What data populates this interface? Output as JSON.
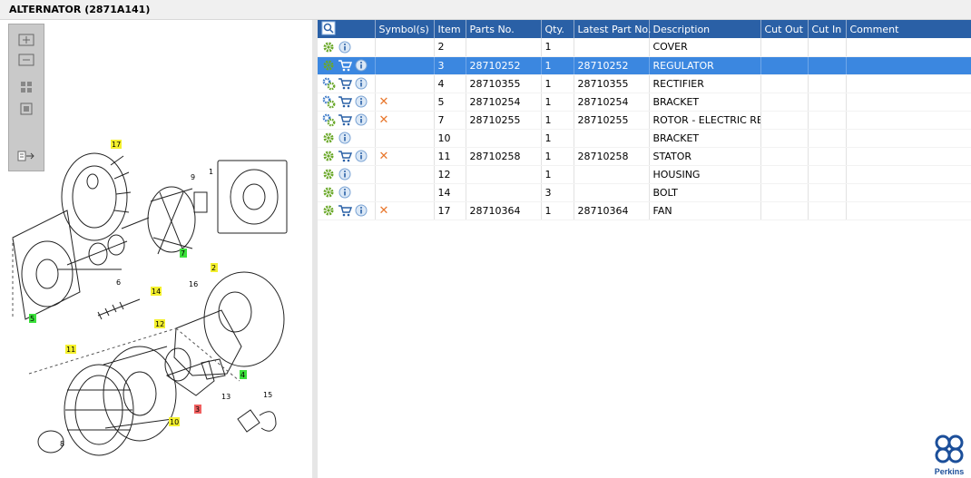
{
  "window": {
    "title": "ALTERNATOR (2871A141)"
  },
  "toolbar": {
    "buttons": [
      "zoom-in",
      "zoom-out",
      "fit-page",
      "actual-size",
      "export"
    ]
  },
  "diagram": {
    "callouts": [
      "17",
      "9",
      "1",
      "2",
      "16",
      "7",
      "6",
      "14",
      "5",
      "12",
      "11",
      "4",
      "13",
      "15",
      "3",
      "10",
      "8"
    ]
  },
  "table": {
    "headers": [
      "Symbol(s)",
      "Item",
      "Parts No.",
      "Qty.",
      "Latest Part No.",
      "Description",
      "Cut Out",
      "Cut In",
      "Comment"
    ],
    "rows": [
      {
        "item": "2",
        "part_no": "",
        "qty": "1",
        "latest": "",
        "desc": "COVER",
        "cart": false,
        "x": false,
        "gears": 1
      },
      {
        "item": "3",
        "part_no": "28710252",
        "qty": "1",
        "latest": "28710252",
        "desc": "REGULATOR",
        "cart": true,
        "x": false,
        "gears": 1,
        "selected": true
      },
      {
        "item": "4",
        "part_no": "28710355",
        "qty": "1",
        "latest": "28710355",
        "desc": "RECTIFIER",
        "cart": true,
        "x": false,
        "gears": 2
      },
      {
        "item": "5",
        "part_no": "28710254",
        "qty": "1",
        "latest": "28710254",
        "desc": "BRACKET",
        "cart": true,
        "x": true,
        "gears": 2
      },
      {
        "item": "7",
        "part_no": "28710255",
        "qty": "1",
        "latest": "28710255",
        "desc": "ROTOR - ELECTRIC REPAIR",
        "cart": true,
        "x": true,
        "gears": 2
      },
      {
        "item": "10",
        "part_no": "",
        "qty": "1",
        "latest": "",
        "desc": "BRACKET",
        "cart": false,
        "x": false,
        "gears": 1
      },
      {
        "item": "11",
        "part_no": "28710258",
        "qty": "1",
        "latest": "28710258",
        "desc": "STATOR",
        "cart": true,
        "x": true,
        "gears": 1
      },
      {
        "item": "12",
        "part_no": "",
        "qty": "1",
        "latest": "",
        "desc": "HOUSING",
        "cart": false,
        "x": false,
        "gears": 1
      },
      {
        "item": "14",
        "part_no": "",
        "qty": "3",
        "latest": "",
        "desc": "BOLT",
        "cart": false,
        "x": false,
        "gears": 1
      },
      {
        "item": "17",
        "part_no": "28710364",
        "qty": "1",
        "latest": "28710364",
        "desc": "FAN",
        "cart": true,
        "x": true,
        "gears": 1
      }
    ]
  },
  "brand": {
    "name": "Perkins"
  },
  "colors": {
    "header": "#2a60a6",
    "selected": "#3b87e0",
    "x_mark": "#e8762b",
    "gear": "#6aa829"
  }
}
